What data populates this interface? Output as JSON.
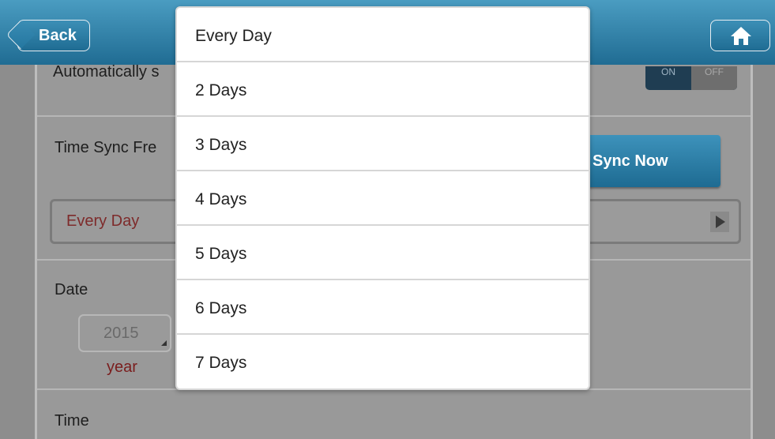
{
  "header": {
    "back_label": "Back",
    "home_icon": "home-icon",
    "accent": "#206c93"
  },
  "settings": {
    "auto_label": "Automatically s",
    "toggle": {
      "on_label": "ON",
      "off_label": "OFF",
      "state": "ON"
    },
    "freq_label": "Time Sync Fre",
    "sync_button": "Sync Now",
    "freq_value": "Every Day",
    "date_label": "Date",
    "year_value": "2015",
    "year_label": "year",
    "time_label": "Time"
  },
  "dropdown": {
    "options": [
      "Every Day",
      "2 Days",
      "3 Days",
      "4 Days",
      "5 Days",
      "6 Days",
      "7 Days"
    ]
  }
}
